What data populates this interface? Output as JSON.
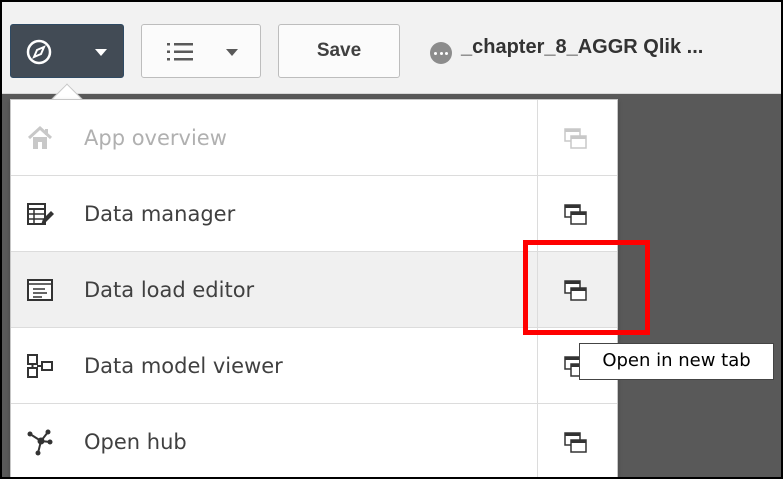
{
  "toolbar": {
    "save_label": "Save",
    "app_title": "_chapter_8_AGGR Qlik ...",
    "nav_icon": "compass-icon",
    "list_icon": "list-icon"
  },
  "menu": {
    "items": [
      {
        "label": "App overview",
        "icon": "home-icon",
        "disabled": true
      },
      {
        "label": "Data manager",
        "icon": "data-manager-icon",
        "disabled": false
      },
      {
        "label": "Data load editor",
        "icon": "data-load-editor-icon",
        "disabled": false
      },
      {
        "label": "Data model viewer",
        "icon": "data-model-icon",
        "disabled": false
      },
      {
        "label": "Open hub",
        "icon": "hub-icon",
        "disabled": false
      }
    ],
    "open_in_new_tab_icon": "open-new-tab-icon"
  },
  "tooltip": {
    "text": "Open in new tab"
  },
  "colors": {
    "nav_button": "#424b55",
    "canvas": "#595959",
    "highlight_box": "#ff0000"
  }
}
